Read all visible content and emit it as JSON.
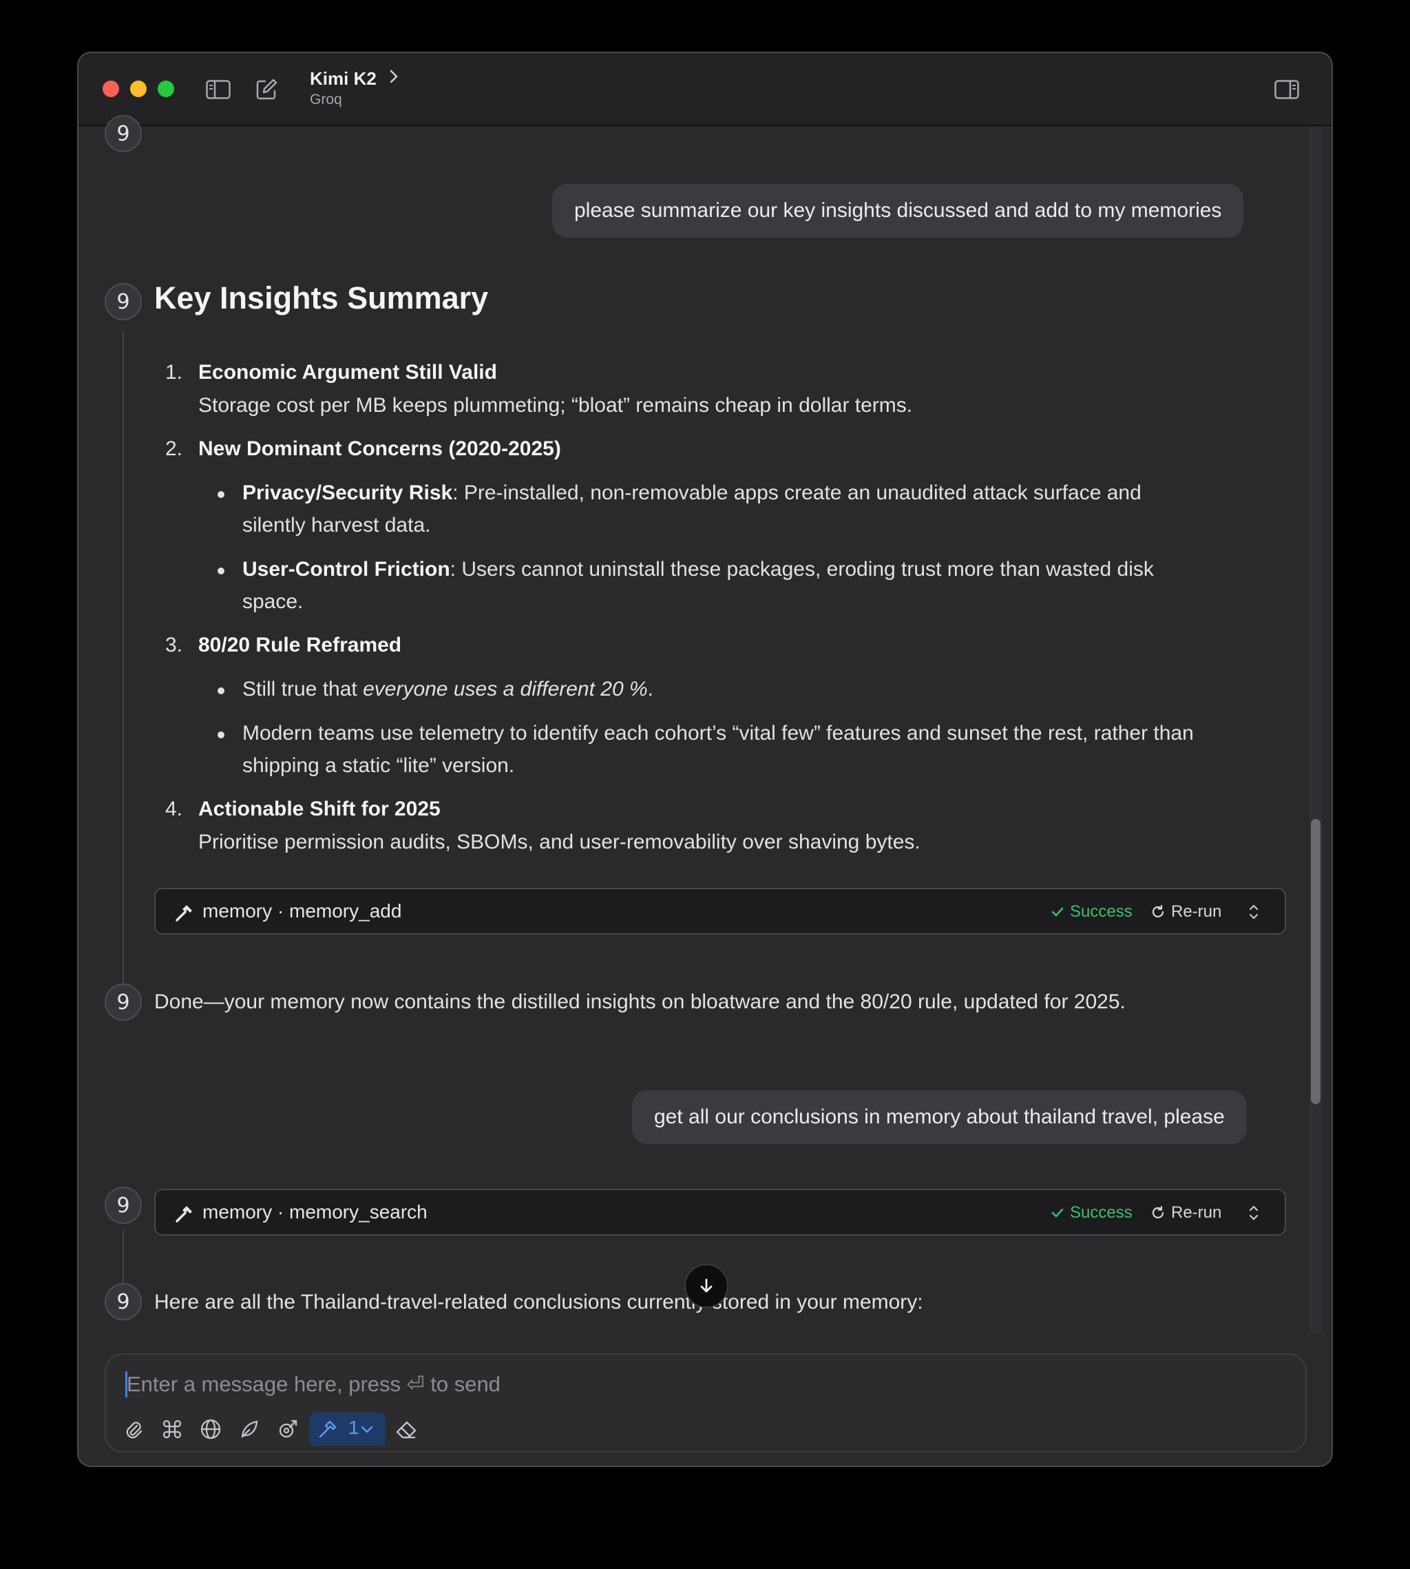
{
  "titlebar": {
    "model_name": "Kimi K2",
    "provider": "Groq"
  },
  "avatar_glyph": "9",
  "messages": {
    "user_1": "please summarize our key insights discussed and add to my memories",
    "summary_title": "Key Insights Summary",
    "insights": [
      {
        "number": "1.",
        "title": "Economic Argument Still Valid",
        "body": "Storage cost per MB keeps plummeting; “bloat” remains cheap in dollar terms."
      },
      {
        "number": "2.",
        "title": "New Dominant Concerns (2020-2025)",
        "bullets": [
          {
            "label": "Privacy/Security Risk",
            "line1": ": Pre-installed, non-removable apps create an unaudited attack surface and",
            "line2": "silently harvest data."
          },
          {
            "label": "User-Control Friction",
            "line1": ": Users cannot uninstall these packages, eroding trust more than wasted disk",
            "line2": "space."
          }
        ]
      },
      {
        "number": "3.",
        "title": "80/20 Rule Reframed",
        "bullets": [
          {
            "prefix": "Still true that ",
            "italic": "everyone uses a different 20 %",
            "suffix": "."
          },
          {
            "line1": "Modern teams use telemetry to identify each cohort’s “vital few” features and sunset the rest, rather than",
            "line2": "shipping a static “lite” version."
          }
        ]
      },
      {
        "number": "4.",
        "title": "Actionable Shift for 2025",
        "body": "Prioritise permission audits, SBOMs, and user-removability over shaving bytes."
      }
    ],
    "tool_call_1": {
      "label": "memory · memory_add",
      "status": "Success",
      "rerun": "Re-run"
    },
    "assistant_done": "Done—your memory now contains the distilled insights on bloatware and the 80/20 rule, updated for 2025.",
    "user_2": "get all our conclusions in memory about thailand travel, please",
    "tool_call_2": {
      "label": "memory · memory_search",
      "status": "Success",
      "rerun": "Re-run"
    },
    "assistant_partial": "Here are all the Thailand-travel-related conclusions currently stored in your memory:"
  },
  "composer": {
    "placeholder": "Enter a message here, press ⏎ to send",
    "value": "",
    "tool_count": "1",
    "icons": [
      "paperclip-icon",
      "command-icon",
      "globe-icon",
      "leaf-icon",
      "rocket-icon",
      "hammer-icon",
      "chevron-down-icon",
      "eraser-icon"
    ]
  },
  "colors": {
    "success": "#3fbf6a",
    "accent": "#3b82f6",
    "traffic_red": "#fe5f57",
    "traffic_yellow": "#febc2e",
    "traffic_green": "#28c840"
  }
}
